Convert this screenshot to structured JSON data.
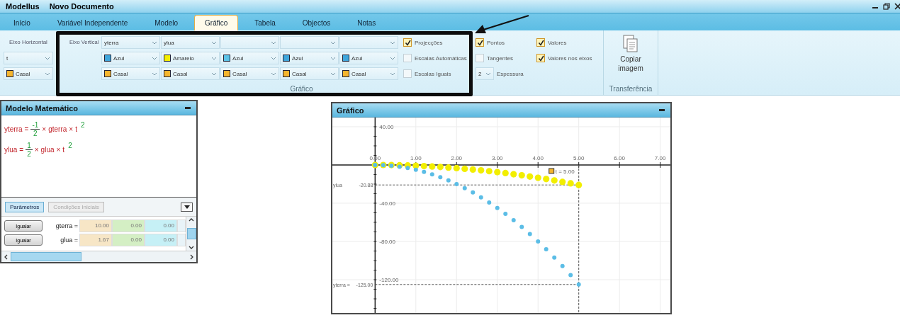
{
  "window": {
    "app": "Modellus",
    "title": "Novo Documento"
  },
  "tabs": [
    {
      "label": "Início",
      "selected": false
    },
    {
      "label": "Variável Independente",
      "selected": false
    },
    {
      "label": "Modelo",
      "selected": false
    },
    {
      "label": "Gráfico",
      "selected": true
    },
    {
      "label": "Tabela",
      "selected": false
    },
    {
      "label": "Objectos",
      "selected": false
    },
    {
      "label": "Notas",
      "selected": false
    }
  ],
  "ribbon": {
    "horizontal_axis": {
      "label": "Eixo Horizontal",
      "variable": "t",
      "style": "Casal"
    },
    "vertical_axis": {
      "label": "Eixo Vertical",
      "columns": [
        {
          "variable": "yterra",
          "color_name": "Azul",
          "color": "#3fa6dc",
          "style": "Casal"
        },
        {
          "variable": "ylua",
          "color_name": "Amarelo",
          "color": "#f5ee00",
          "style": "Casal"
        },
        {
          "color_name": "Azul",
          "color": "#5bc3e8",
          "style": "Casal"
        },
        {
          "color_name": "Azul",
          "color": "#3fa6dc",
          "style": "Casal"
        },
        {
          "color_name": "Azul",
          "color": "#3fa6dc",
          "style": "Casal"
        }
      ]
    },
    "options": [
      {
        "kind": "checkbox",
        "label": "Projecções",
        "checked": true
      },
      {
        "kind": "checkbox",
        "label": "Escalas Automáticas",
        "checked": false
      },
      {
        "kind": "checkbox",
        "label": "Escalas Iguais",
        "checked": false
      },
      {
        "kind": "checkbox",
        "label": "Pontos",
        "checked": true
      },
      {
        "kind": "checkbox",
        "label": "Tangentes",
        "checked": false
      },
      {
        "kind": "spin",
        "value": "2",
        "label": "Espessura"
      },
      {
        "kind": "checkbox",
        "label": "Valores",
        "checked": true
      },
      {
        "kind": "checkbox",
        "label": "Valores nos eixos",
        "checked": true
      }
    ],
    "group_label": "Gráfico",
    "copy_button": "Copiar imagem",
    "copy_group_label": "Transferência"
  },
  "model": {
    "title": "Modelo Matemático",
    "equations": [
      [
        {
          "kind": "var",
          "text": "yterra"
        },
        {
          "kind": "op",
          "text": "="
        },
        {
          "kind": "frac",
          "num": "-1",
          "den": "2"
        },
        {
          "kind": "op",
          "text": "×"
        },
        {
          "kind": "var",
          "text": "gterra"
        },
        {
          "kind": "op",
          "text": "×"
        },
        {
          "kind": "var",
          "text": "t"
        },
        {
          "kind": "exp",
          "text": "2"
        }
      ],
      [
        {
          "kind": "var",
          "text": "ylua"
        },
        {
          "kind": "op",
          "text": "="
        },
        {
          "kind": "frac",
          "num": "1",
          "den": "2"
        },
        {
          "kind": "op",
          "text": "×"
        },
        {
          "kind": "var",
          "text": "glua"
        },
        {
          "kind": "op",
          "text": "×"
        },
        {
          "kind": "var",
          "text": "t"
        },
        {
          "kind": "exp",
          "text": "2"
        }
      ]
    ],
    "tabs": [
      {
        "label": "Parâmetros",
        "selected": true
      },
      {
        "label": "Condições Iniciais",
        "selected": false
      }
    ],
    "parameters": [
      {
        "button": "Igualar",
        "name": "gterra =",
        "values": [
          "10.00",
          "0.00",
          "0.00"
        ]
      },
      {
        "button": "Igualar",
        "name": "glua =",
        "values": [
          "1.67",
          "0.00",
          "0.00"
        ]
      }
    ]
  },
  "graph": {
    "title": "Gráfico",
    "chart_data": {
      "type": "scatter",
      "x": [
        0,
        0.2,
        0.4,
        0.6,
        0.8,
        1,
        1.2,
        1.4,
        1.6,
        1.8,
        2,
        2.2,
        2.4,
        2.6,
        2.8,
        3,
        3.2,
        3.4,
        3.6,
        3.8,
        4,
        4.2,
        4.4,
        4.6,
        4.8,
        5
      ],
      "series": [
        {
          "color": "#f2ee00",
          "values": [
            0,
            0,
            -0.1,
            -0.3,
            -0.5,
            -0.8,
            -1.2,
            -1.6,
            -2.1,
            -2.7,
            -3.3,
            -4,
            -4.8,
            -5.6,
            -6.5,
            -7.5,
            -8.5,
            -9.7,
            -10.8,
            -12.1,
            -13.4,
            -14.7,
            -16.2,
            -17.7,
            -19.2,
            -20.9
          ]
        },
        {
          "color": "#5bbde6",
          "values": [
            0,
            -0.2,
            -0.8,
            -1.8,
            -3.2,
            -5,
            -7.2,
            -9.8,
            -12.8,
            -16.2,
            -20,
            -24.2,
            -28.8,
            -33.8,
            -39.2,
            -45,
            -51.2,
            -57.8,
            -64.8,
            -72.2,
            -80,
            -88.2,
            -96.8,
            -105.8,
            -115.2,
            -125
          ]
        }
      ],
      "grid": true,
      "xlim": [
        -1.05,
        7.25
      ],
      "ylim": [
        -157,
        49.6
      ],
      "xticks": [
        {
          "value": 0,
          "label": "0.00"
        },
        {
          "value": 1,
          "label": "1.00"
        },
        {
          "value": 2,
          "label": "2.00"
        },
        {
          "value": 3,
          "label": "3.00"
        },
        {
          "value": 4,
          "label": "4.00"
        },
        {
          "value": 5,
          "label": "5.00"
        },
        {
          "value": 6,
          "label": "6.00"
        },
        {
          "value": 7,
          "label": "7.00"
        }
      ],
      "yticks": [
        {
          "value": 40,
          "label": "40.00"
        },
        {
          "value": -40,
          "label": "-40.00"
        },
        {
          "value": -80,
          "label": "-80.00"
        },
        {
          "value": -120,
          "label": "-120.00"
        }
      ]
    },
    "projections": [
      {
        "label": "ylua",
        "value": "-20.88"
      },
      {
        "label": "yterra =",
        "value": "-125.00"
      }
    ],
    "time_label": "t = 5.00"
  }
}
